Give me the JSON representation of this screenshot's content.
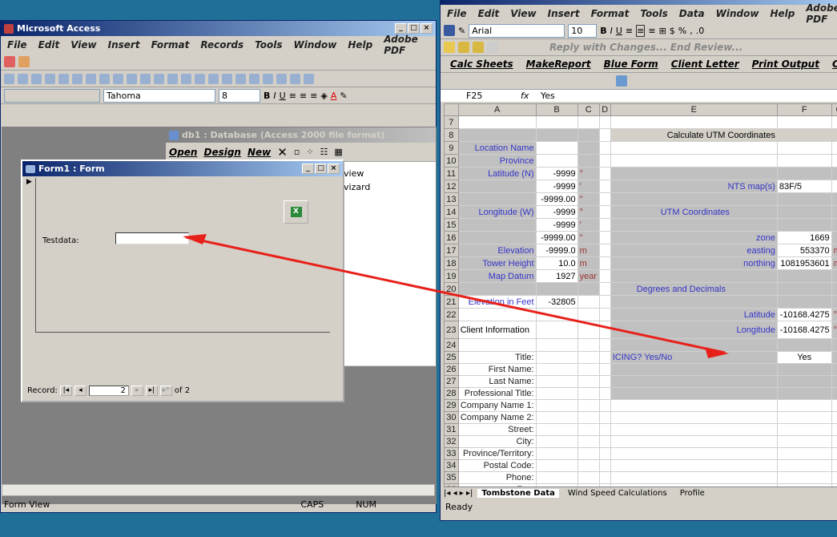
{
  "access": {
    "title": "Microsoft Access",
    "menu": [
      "File",
      "Edit",
      "View",
      "Insert",
      "Format",
      "Records",
      "Tools",
      "Window",
      "Help",
      "Adobe PDF"
    ],
    "font": "Tahoma",
    "size": "8",
    "status": "Form View",
    "caps": "CAPS",
    "num": "NUM"
  },
  "db": {
    "title": "db1 : Database (Access 2000 file format)",
    "open": "Open",
    "design": "Design",
    "new": "New",
    "items": [
      "view",
      "vizard"
    ]
  },
  "form": {
    "title": "Form1 : Form",
    "field_label": "Testdata:",
    "field_value": "",
    "record_label": "Record:",
    "record_value": "2",
    "record_of": "of 2"
  },
  "excel": {
    "menu": [
      "File",
      "Edit",
      "View",
      "Insert",
      "Format",
      "Tools",
      "Data",
      "Window",
      "Help",
      "Adobe PDF"
    ],
    "font": "Arial",
    "size": "10",
    "review": "Reply with Changes...   End Review...",
    "macros": [
      "Calc Sheets",
      "MakeReport",
      "Blue Form",
      "Client Letter",
      "Print Output",
      "Cle"
    ],
    "namebox": "F25",
    "fx": "fx",
    "formula": "Yes",
    "columns": [
      "A",
      "B",
      "C",
      "D",
      "E",
      "F",
      "G"
    ],
    "tabs": [
      "Tombstone Data",
      "Wind Speed Calculations",
      "Profile"
    ],
    "status": "Ready"
  },
  "sheet": {
    "rows": [
      {
        "r": "7"
      },
      {
        "r": "8",
        "E": "Calculate UTM Coordinates"
      },
      {
        "r": "9",
        "A": "Location Name"
      },
      {
        "r": "10",
        "A": "Province"
      },
      {
        "r": "11",
        "A": "Latitude (N)",
        "B": "-9999",
        "C": "°"
      },
      {
        "r": "12",
        "B": "-9999",
        "C": "'",
        "E": "NTS map(s)",
        "F": "83F/5"
      },
      {
        "r": "13",
        "B": "-9999.00",
        "C": "\""
      },
      {
        "r": "14",
        "A": "Longitude (W)",
        "B": "-9999",
        "C": "°",
        "E": "UTM Coordinates"
      },
      {
        "r": "15",
        "B": "-9999",
        "C": "'"
      },
      {
        "r": "16",
        "B": "-9999.00",
        "C": "\"",
        "E": "zone",
        "F": "1669"
      },
      {
        "r": "17",
        "A": "Elevation",
        "B": "-9999.0",
        "C": "m",
        "E": "easting",
        "F": "553370",
        "G": "m"
      },
      {
        "r": "18",
        "A": "Tower Height",
        "B": "10.0",
        "C": "m",
        "E": "northing",
        "F": "1081953601",
        "G": "m"
      },
      {
        "r": "19",
        "A": "Map Datum",
        "B": "1927",
        "C": "year"
      },
      {
        "r": "20",
        "E": "Degrees and Decimals"
      },
      {
        "r": "21",
        "A": "Elevation in Feet",
        "B": "-32805"
      },
      {
        "r": "22",
        "E": "Latitude",
        "F": "-10168.4275",
        "G": "°"
      },
      {
        "r": "23",
        "A": "Client Information",
        "E": "Longitude",
        "F": "-10168.4275",
        "G": "°"
      },
      {
        "r": "24"
      },
      {
        "r": "25",
        "A": "Title:",
        "E": "ICING? Yes/No",
        "F": "Yes"
      },
      {
        "r": "26",
        "A": "First Name:"
      },
      {
        "r": "27",
        "A": "Last Name:"
      },
      {
        "r": "28",
        "A": "Professional Title:"
      },
      {
        "r": "29",
        "A": "Company Name 1:"
      },
      {
        "r": "30",
        "A": "Company Name 2:"
      },
      {
        "r": "31",
        "A": "Street:"
      },
      {
        "r": "32",
        "A": "City:"
      },
      {
        "r": "33",
        "A": "Province/Territory:"
      },
      {
        "r": "34",
        "A": "Postal Code:"
      },
      {
        "r": "35",
        "A": "Phone:"
      },
      {
        "r": "36",
        "A": "Fax:"
      }
    ]
  },
  "colors": {
    "desktop": "#1f6f98",
    "arrow": "#e8201a",
    "label": "#3535c8"
  }
}
